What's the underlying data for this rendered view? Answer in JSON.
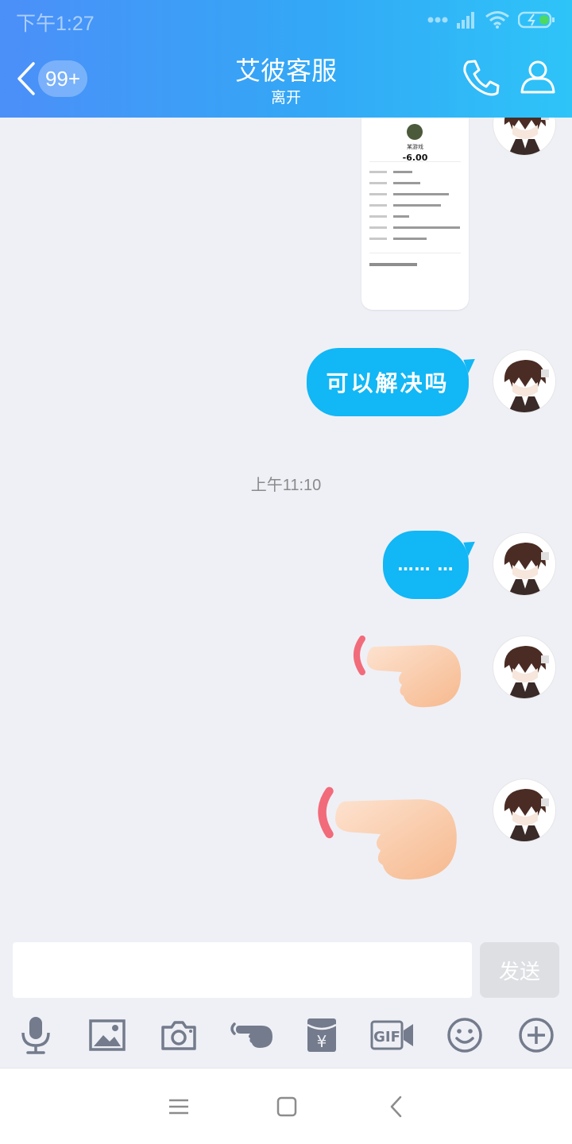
{
  "status_bar": {
    "time": "下午1:27"
  },
  "header": {
    "back_badge": "99+",
    "title": "艾彼客服",
    "subtitle": "离开"
  },
  "chat": {
    "screenshot_card": {
      "name": "某游戏",
      "amount": "-6.00"
    },
    "messages": [
      {
        "text": "可以解决吗"
      },
      {
        "text": "…… …"
      }
    ],
    "timestamp": "上午11:10"
  },
  "input": {
    "placeholder": "",
    "send_label": "发送"
  },
  "toolbar": {
    "icons": [
      "microphone-icon",
      "image-icon",
      "camera-icon",
      "poke-icon",
      "red-packet-icon",
      "gif-icon",
      "emoji-icon",
      "plus-icon"
    ],
    "gif_label": "GIF",
    "yuan_label": "¥"
  },
  "colors": {
    "header_start": "#4b8ff8",
    "header_end": "#2ec4f8",
    "bubble": "#12b7f5",
    "background": "#eff0f6"
  }
}
